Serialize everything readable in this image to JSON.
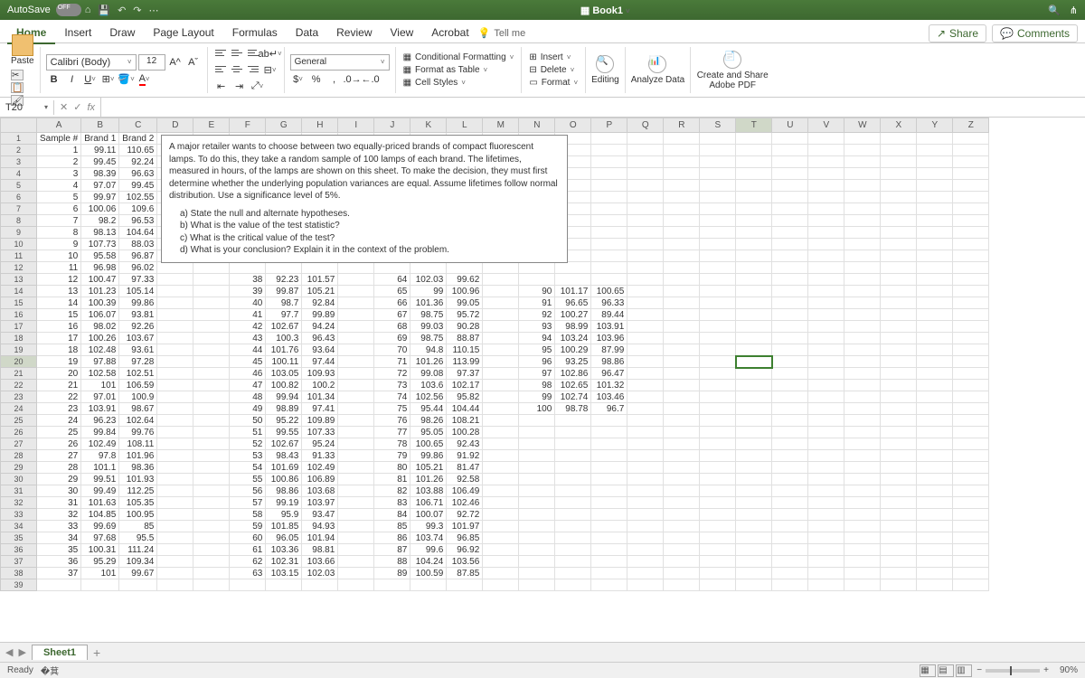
{
  "title": "Book1",
  "autosave": "AutoSave",
  "tabs": [
    "Home",
    "Insert",
    "Draw",
    "Page Layout",
    "Formulas",
    "Data",
    "Review",
    "View",
    "Acrobat"
  ],
  "tellme": "Tell me",
  "share": "Share",
  "comments": "Comments",
  "paste": "Paste",
  "font": {
    "name": "Calibri (Body)",
    "size": "12"
  },
  "number": "General",
  "styles": {
    "cf": "Conditional Formatting",
    "fat": "Format as Table",
    "cs": "Cell Styles"
  },
  "cells": {
    "ins": "Insert",
    "del": "Delete",
    "fmt": "Format"
  },
  "editing": "Editing",
  "analyze": "Analyze Data",
  "create": "Create and Share Adobe PDF",
  "namebox": "T20",
  "fx": "fx",
  "cols": [
    "A",
    "B",
    "C",
    "D",
    "E",
    "F",
    "G",
    "H",
    "I",
    "J",
    "K",
    "L",
    "M",
    "N",
    "O",
    "P",
    "Q",
    "R",
    "S",
    "T",
    "U",
    "V",
    "W",
    "X",
    "Y",
    "Z"
  ],
  "hdr": {
    "a": "Sample #",
    "b": "Brand 1",
    "c": "Brand 2"
  },
  "desc": {
    "p": "A major retailer wants to choose between two equally-priced brands of compact fluorescent lamps. To do this, they take a random sample of 100 lamps of each brand. The lifetimes, measured in hours, of the lamps are shown on this sheet. To make the decision, they must first determine whether the underlying population variances are equal. Assume lifetimes follow normal distribution.  Use a significance level of 5%.",
    "a": "a)   State the null and alternate hypotheses.",
    "b": "b)   What is the value of the test statistic?",
    "c": "c)   What is the critical value of the test?",
    "d": "d)   What is your conclusion? Explain it in the context of the problem."
  },
  "d1": [
    [
      1,
      99.11,
      110.65
    ],
    [
      2,
      99.45,
      92.24
    ],
    [
      3,
      98.39,
      96.63
    ],
    [
      4,
      97.07,
      99.45
    ],
    [
      5,
      99.97,
      102.55
    ],
    [
      6,
      100.06,
      109.6
    ],
    [
      7,
      98.2,
      96.53
    ],
    [
      8,
      98.13,
      104.64
    ],
    [
      9,
      107.73,
      88.03
    ],
    [
      10,
      95.58,
      96.87
    ],
    [
      11,
      96.98,
      96.02
    ],
    [
      12,
      100.47,
      97.33
    ],
    [
      13,
      101.23,
      105.14
    ],
    [
      14,
      100.39,
      99.86
    ],
    [
      15,
      106.07,
      93.81
    ],
    [
      16,
      98.02,
      92.26
    ],
    [
      17,
      100.26,
      103.67
    ],
    [
      18,
      102.48,
      93.61
    ],
    [
      19,
      97.88,
      97.28
    ],
    [
      20,
      102.58,
      102.51
    ],
    [
      21,
      101,
      106.59
    ],
    [
      22,
      97.01,
      100.9
    ],
    [
      23,
      103.91,
      98.67
    ],
    [
      24,
      96.23,
      102.64
    ],
    [
      25,
      99.84,
      99.76
    ],
    [
      26,
      102.49,
      108.11
    ],
    [
      27,
      97.8,
      101.96
    ],
    [
      28,
      101.1,
      98.36
    ],
    [
      29,
      99.51,
      101.93
    ],
    [
      30,
      99.49,
      112.25
    ],
    [
      31,
      101.63,
      105.35
    ],
    [
      32,
      104.85,
      100.95
    ],
    [
      33,
      99.69,
      85.0
    ],
    [
      34,
      97.68,
      95.5
    ],
    [
      35,
      100.31,
      111.24
    ],
    [
      36,
      95.29,
      109.34
    ],
    [
      37,
      101,
      99.67
    ]
  ],
  "d2": [
    [
      38,
      92.23,
      101.57
    ],
    [
      39,
      99.87,
      105.21
    ],
    [
      40,
      98.7,
      92.84
    ],
    [
      41,
      97.7,
      99.89
    ],
    [
      42,
      102.67,
      94.24
    ],
    [
      43,
      100.3,
      96.43
    ],
    [
      44,
      101.76,
      93.64
    ],
    [
      45,
      100.11,
      97.44
    ],
    [
      46,
      103.05,
      109.93
    ],
    [
      47,
      100.82,
      100.2
    ],
    [
      48,
      99.94,
      101.34
    ],
    [
      49,
      98.89,
      97.41
    ],
    [
      50,
      95.22,
      109.89
    ],
    [
      51,
      99.55,
      107.33
    ],
    [
      52,
      102.67,
      95.24
    ],
    [
      53,
      98.43,
      91.33
    ],
    [
      54,
      101.69,
      102.49
    ],
    [
      55,
      100.86,
      106.89
    ],
    [
      56,
      98.86,
      103.68
    ],
    [
      57,
      99.19,
      103.97
    ],
    [
      58,
      95.9,
      93.47
    ],
    [
      59,
      101.85,
      94.93
    ],
    [
      60,
      96.05,
      101.94
    ],
    [
      61,
      103.36,
      98.81
    ],
    [
      62,
      102.31,
      103.66
    ],
    [
      63,
      103.15,
      102.03
    ]
  ],
  "d3": [
    [
      64,
      102.03,
      99.62
    ],
    [
      65,
      99,
      100.96
    ],
    [
      66,
      101.36,
      99.05
    ],
    [
      67,
      98.75,
      95.72
    ],
    [
      68,
      99.03,
      90.28
    ],
    [
      69,
      98.75,
      88.87
    ],
    [
      70,
      94.8,
      110.15
    ],
    [
      71,
      101.26,
      113.99
    ],
    [
      72,
      99.08,
      97.37
    ],
    [
      73,
      103.6,
      102.17
    ],
    [
      74,
      102.56,
      95.82
    ],
    [
      75,
      95.44,
      104.44
    ],
    [
      76,
      98.26,
      108.21
    ],
    [
      77,
      95.05,
      100.28
    ],
    [
      78,
      100.65,
      92.43
    ],
    [
      79,
      99.86,
      91.92
    ],
    [
      80,
      105.21,
      81.47
    ],
    [
      81,
      101.26,
      92.58
    ],
    [
      82,
      103.88,
      106.49
    ],
    [
      83,
      106.71,
      102.46
    ],
    [
      84,
      100.07,
      92.72
    ],
    [
      85,
      99.3,
      101.97
    ],
    [
      86,
      103.74,
      96.85
    ],
    [
      87,
      99.6,
      96.92
    ],
    [
      88,
      104.24,
      103.56
    ],
    [
      89,
      100.59,
      87.85
    ]
  ],
  "d4": [
    [
      90,
      101.17,
      100.65
    ],
    [
      91,
      96.65,
      96.33
    ],
    [
      92,
      100.27,
      89.44
    ],
    [
      93,
      98.99,
      103.91
    ],
    [
      94,
      103.24,
      103.96
    ],
    [
      95,
      100.29,
      87.99
    ],
    [
      96,
      93.25,
      98.86
    ],
    [
      97,
      102.86,
      96.47
    ],
    [
      98,
      102.65,
      101.32
    ],
    [
      99,
      102.74,
      103.46
    ],
    [
      100,
      98.78,
      96.7
    ]
  ],
  "sheet": "Sheet1",
  "ready": "Ready",
  "zoom": "90%"
}
